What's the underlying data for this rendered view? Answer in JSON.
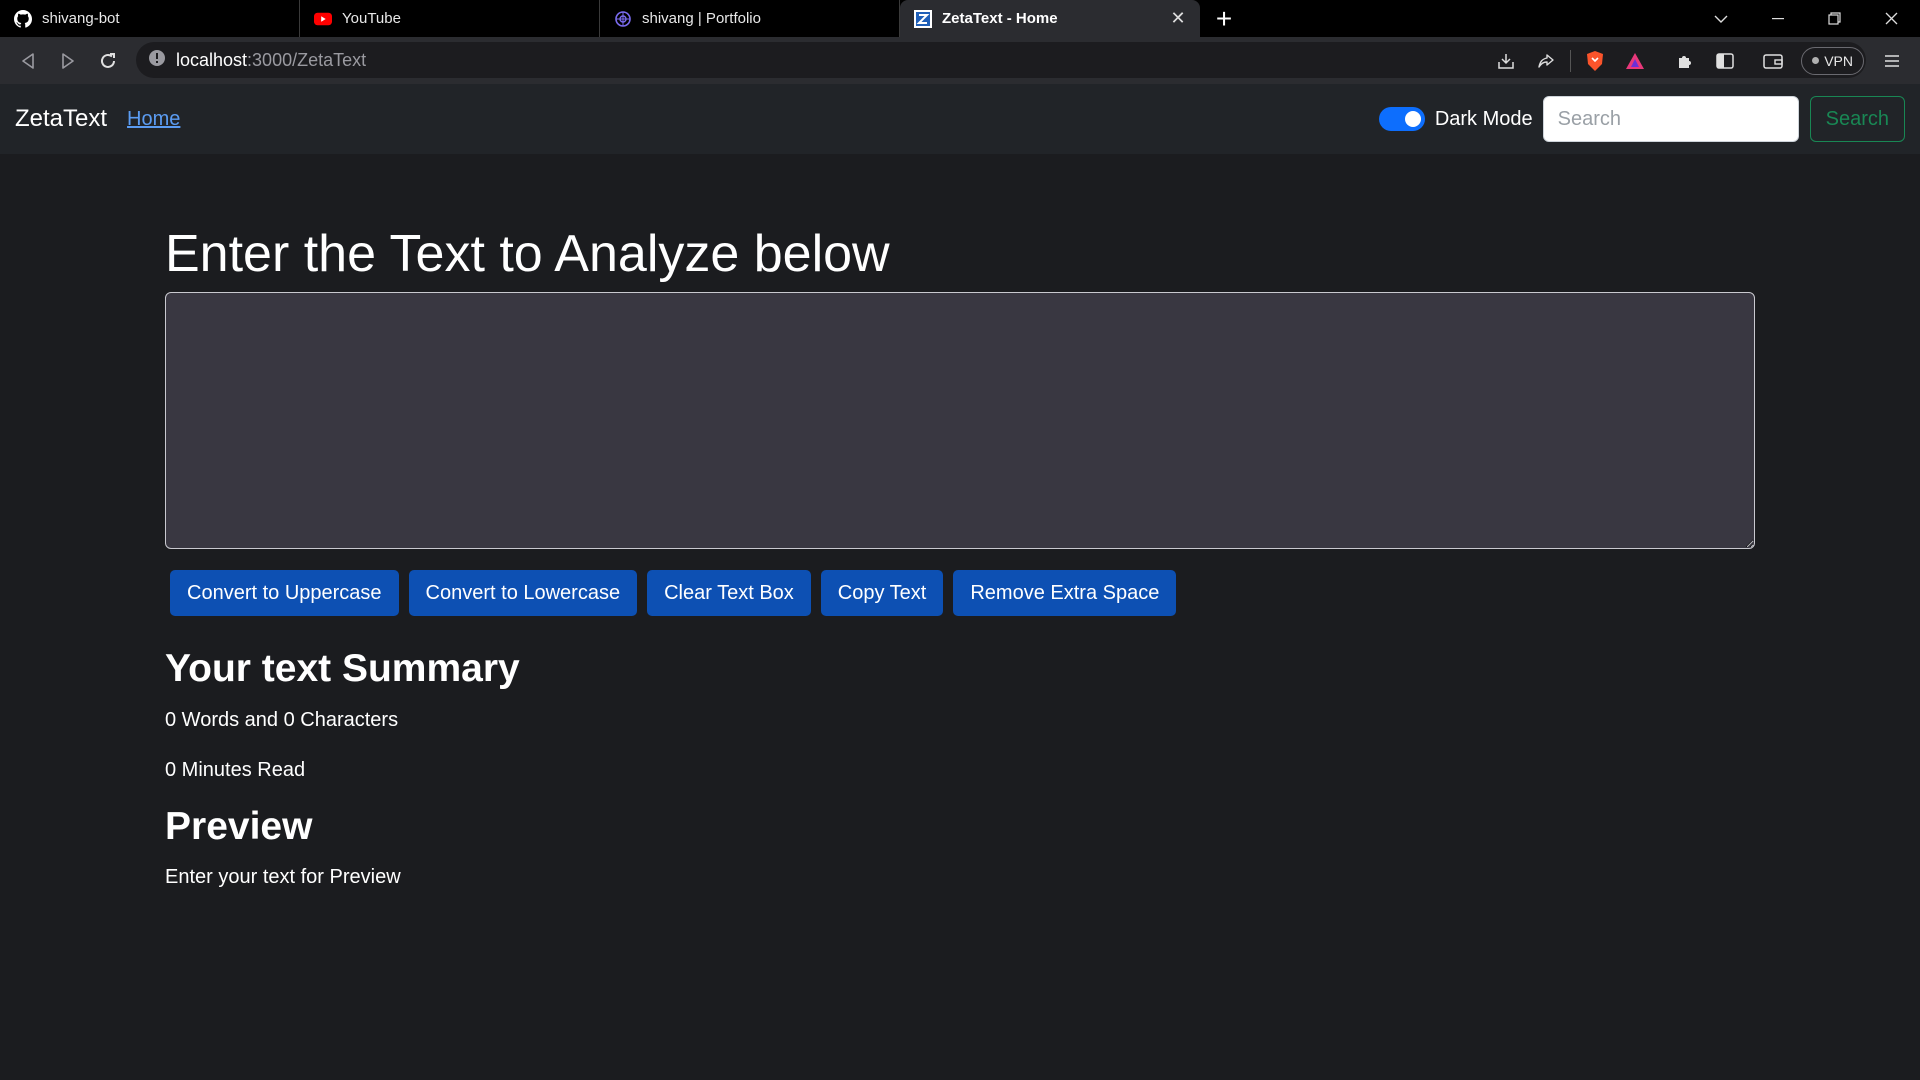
{
  "browser": {
    "tabs": [
      {
        "title": "shivang-bot",
        "icon": "github-icon"
      },
      {
        "title": "YouTube",
        "icon": "youtube-icon"
      },
      {
        "title": "shivang | Portfolio",
        "icon": "portfolio-icon"
      },
      {
        "title": "ZetaText - Home",
        "icon": "zetatext-icon",
        "active": true
      }
    ],
    "url_host": "localhost",
    "url_path": ":3000/ZetaText",
    "vpn_label": "VPN"
  },
  "navbar": {
    "brand": "ZetaText",
    "home_link": "Home",
    "dark_mode_label": "Dark Mode",
    "dark_mode_on": true,
    "search_placeholder": "Search",
    "search_button": "Search"
  },
  "main": {
    "heading": "Enter the Text to Analyze below",
    "textbox_value": "",
    "buttons": [
      "Convert to Uppercase",
      "Convert to Lowercase",
      "Clear Text Box",
      "Copy Text",
      "Remove Extra Space"
    ],
    "summary_title": "Your text Summary",
    "word_char_count": "0 Words and 0 Characters",
    "minutes_read": "0 Minutes Read",
    "preview_title": "Preview",
    "preview_text": "Enter your text for Preview"
  },
  "colors": {
    "page_bg": "#1b1c1f",
    "navbar_bg": "#212428",
    "textbox_bg": "#393741",
    "button_bg": "#0d50b3",
    "search_button": "#198754",
    "switch_on": "#0d6efd",
    "link": "#5b9cf2"
  }
}
